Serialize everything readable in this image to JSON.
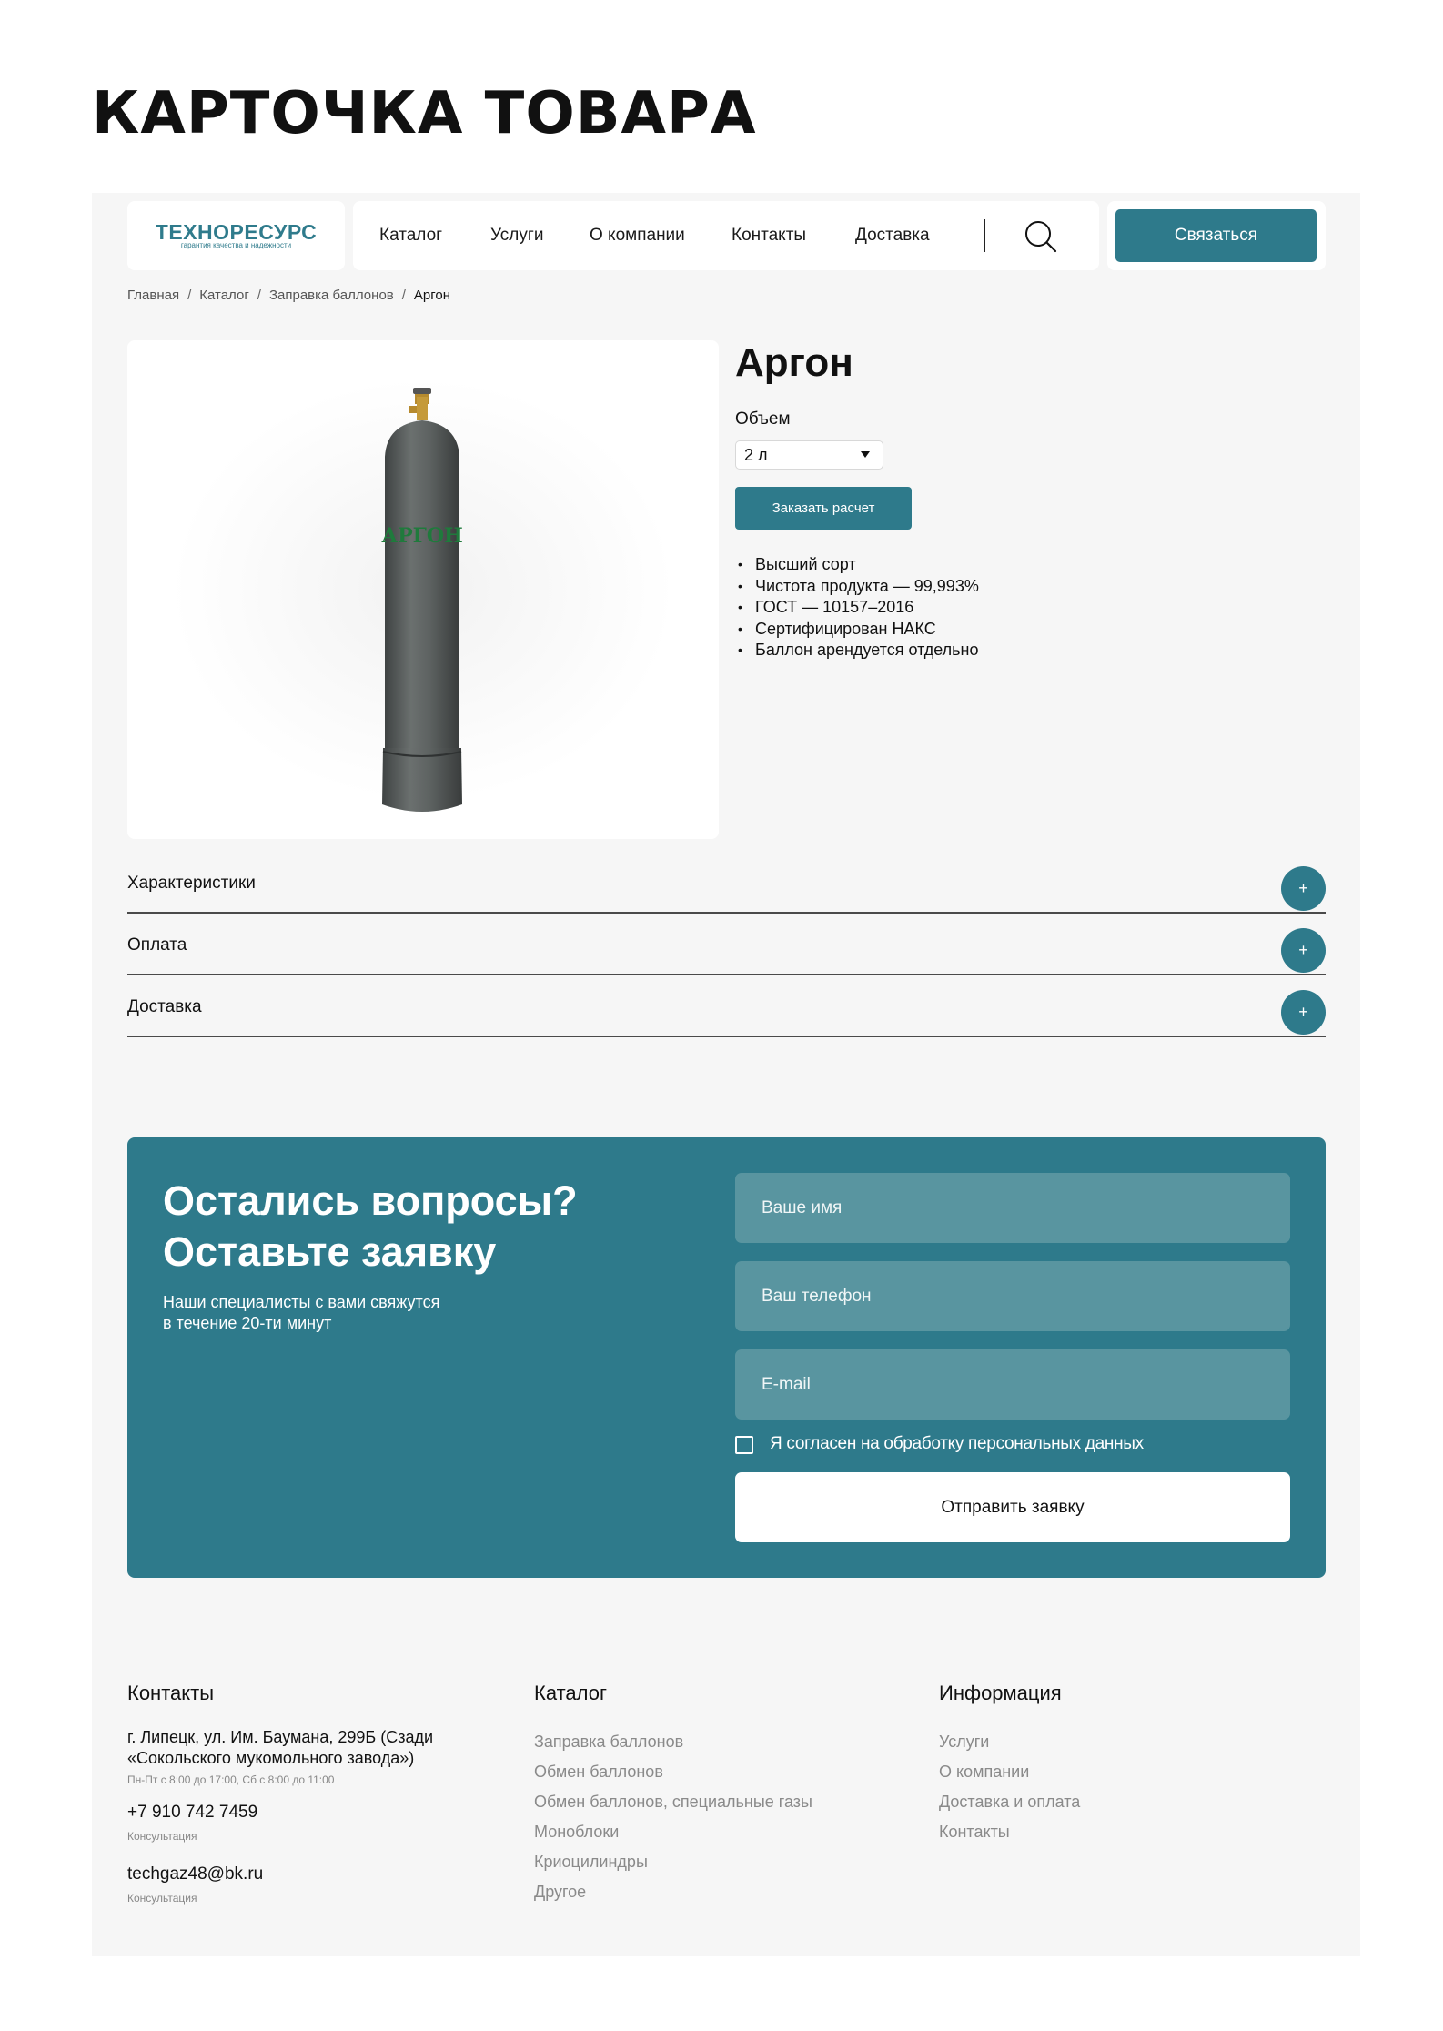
{
  "page_heading": "КАРТОЧКА ТОВАРА",
  "header": {
    "logo": {
      "main": "ТЕХНОРЕСУРС",
      "tagline": "гарантия качества и надежности"
    },
    "nav": [
      "Каталог",
      "Услуги",
      "О компании",
      "Контакты",
      "Доставка"
    ],
    "contact_button": "Связаться"
  },
  "breadcrumb": [
    "Главная",
    "Каталог",
    "Заправка баллонов",
    "Аргон"
  ],
  "product": {
    "title": "Аргон",
    "cylinder_label": "АРГОН",
    "volume_label": "Объем",
    "volume_value": "2 л",
    "order_button": "Заказать расчет",
    "features": [
      "Высший сорт",
      "Чистота продукта — 99,993%",
      "ГОСТ — 10157–2016",
      "Сертифицирован НАКС",
      "Баллон арендуется отдельно"
    ]
  },
  "accordion": [
    {
      "label": "Характеристики",
      "icon": "+"
    },
    {
      "label": "Оплата",
      "icon": "+"
    },
    {
      "label": "Доставка",
      "icon": "+"
    }
  ],
  "lead_form": {
    "title_line1": "Остались вопросы?",
    "title_line2": "Оставьте заявку",
    "subtitle_line1": "Наши специалисты с вами свяжутся",
    "subtitle_line2": "в течение 20-ти минут",
    "name_placeholder": "Ваше имя",
    "phone_placeholder": "Ваш телефон",
    "email_placeholder": "E-mail",
    "consent": "Я согласен на обработку персональных данных",
    "submit": "Отправить заявку"
  },
  "footer": {
    "contacts": {
      "title": "Контакты",
      "address": "г. Липецк, ул. Им. Баумана, 299Б (Сзади «Сокольского мукомольного завода»)",
      "hours": "Пн-Пт с 8:00 до 17:00, Сб с 8:00 до 11:00",
      "phone": "+7 910 742 7459",
      "phone_note": "Консультация",
      "email": "techgaz48@bk.ru",
      "email_note": "Консультация"
    },
    "catalog": {
      "title": "Каталог",
      "links": [
        "Заправка баллонов",
        "Обмен баллонов",
        "Обмен баллонов, специальные газы",
        "Моноблоки",
        "Криоцилиндры",
        "Другое"
      ]
    },
    "info": {
      "title": "Информация",
      "links": [
        "Услуги",
        "О компании",
        "Доставка и оплата",
        "Контакты"
      ]
    }
  },
  "colors": {
    "accent": "#2e7a8b",
    "field": "#5995a0",
    "background": "#f6f6f6"
  }
}
